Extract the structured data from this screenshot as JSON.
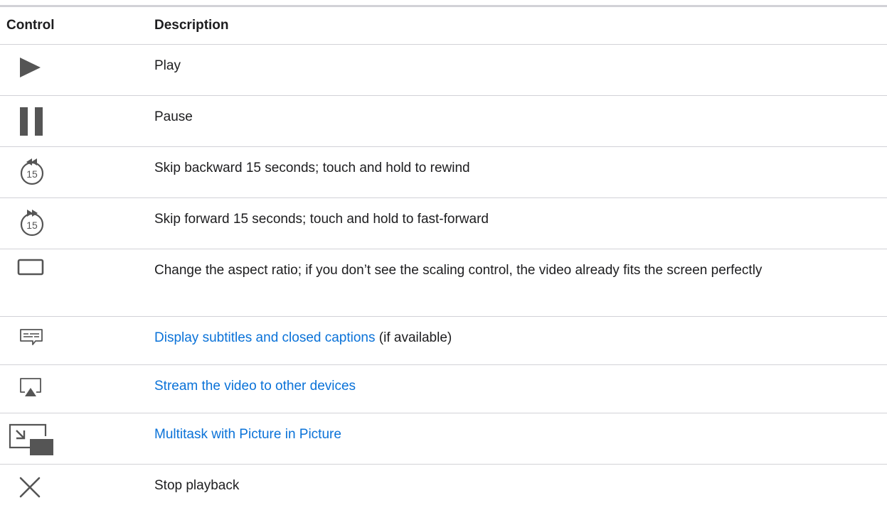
{
  "header": {
    "control": "Control",
    "description": "Description"
  },
  "rows": [
    {
      "icon": "play-icon",
      "text": "Play"
    },
    {
      "icon": "pause-icon",
      "text": "Pause"
    },
    {
      "icon": "skip-backward-15-icon",
      "text": "Skip backward 15 seconds; touch and hold to rewind",
      "icon_label": "15"
    },
    {
      "icon": "skip-forward-15-icon",
      "text": "Skip forward 15 seconds; touch and hold to fast-forward",
      "icon_label": "15"
    },
    {
      "icon": "aspect-ratio-icon",
      "text": "Change the aspect ratio; if you don’t see the scaling control, the video already fits the screen perfectly"
    },
    {
      "icon": "subtitles-icon",
      "link": "Display subtitles and closed captions",
      "suffix": " (if available)"
    },
    {
      "icon": "airplay-icon",
      "link": "Stream the video to other devices"
    },
    {
      "icon": "picture-in-picture-icon",
      "link": "Multitask with Picture in Picture"
    },
    {
      "icon": "close-icon",
      "text": "Stop playback"
    }
  ],
  "colors": {
    "text": "#1d1d1f",
    "link": "#0a72d8",
    "icon": "#555555",
    "divider": "#d2d2d7"
  }
}
